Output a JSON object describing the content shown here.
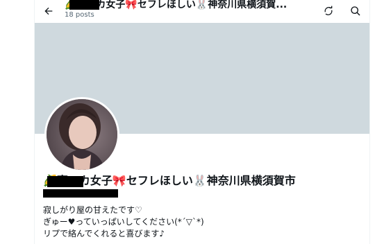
{
  "header": {
    "title": "🌽裏アカ女子🎀セフレほしい🐰神奈川県横須賀...",
    "posts": "18 posts",
    "back_icon": "arrow-left-icon",
    "refresh_icon": "refresh-icon",
    "search_icon": "search-icon"
  },
  "profile": {
    "display_name": "🌽裏アカ女子🎀セフレほしい🐰神奈川県横須賀市",
    "bio_lines": [
      "寂しがり屋の甘えたです♡",
      "ぎゅー♥っていっぱいしてください(*´▽`*)",
      "リプで絡んでくれると喜びます♪"
    ]
  },
  "colors": {
    "banner": "#cfd9de",
    "text": "#0f1419",
    "secondary_text": "#536471"
  }
}
